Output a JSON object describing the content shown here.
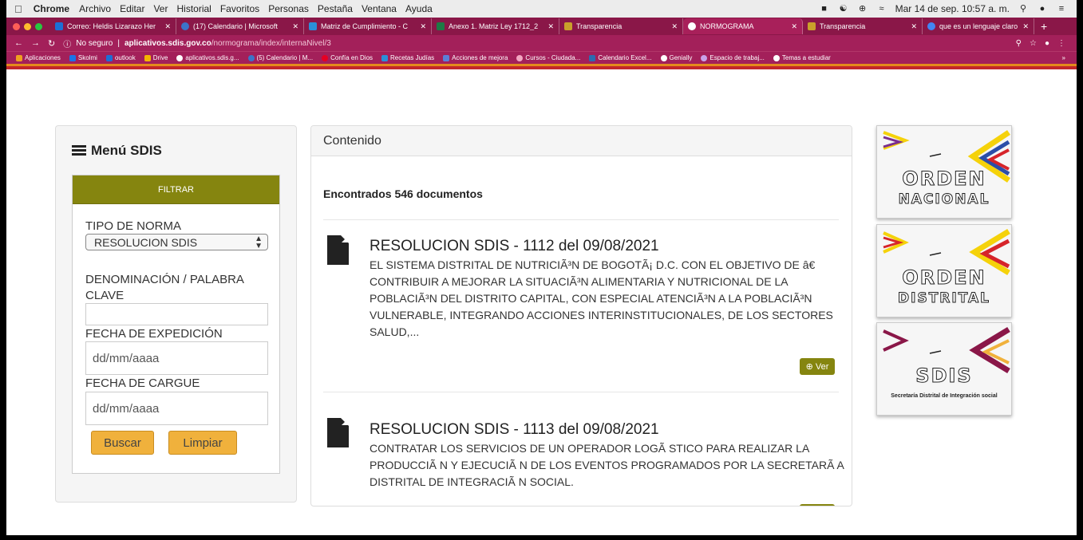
{
  "menubar": {
    "app": "Chrome",
    "items": [
      "Archivo",
      "Editar",
      "Ver",
      "Historial",
      "Favoritos",
      "Personas",
      "Pestaña",
      "Ventana",
      "Ayuda"
    ],
    "datetime": "Mar 14 de sep. 10:57 a. m."
  },
  "tabs": [
    {
      "title": "Correo: Heldis Lizarazo Her",
      "color": "#1c6fd6"
    },
    {
      "title": "(17) Calendario | Microsoft",
      "color": "#3b74c9"
    },
    {
      "title": "Matriz de Cumplimiento - C",
      "color": "#2b8fd8"
    },
    {
      "title": "Anexo 1. Matriz Ley 1712_2",
      "color": "#1e7a45"
    },
    {
      "title": "Transparencia",
      "color": "#c9a12b"
    },
    {
      "title": "NORMOGRAMA",
      "color": "#ffffff",
      "active": true
    },
    {
      "title": "Transparencia",
      "color": "#c9a12b"
    },
    {
      "title": "que es un lenguaje claro -",
      "color": "#4285f4"
    }
  ],
  "address": {
    "security": "No seguro",
    "domain": "aplicativos.sdis.gov.co",
    "path": "/normograma/index/internaNivel/3"
  },
  "bookmarks": [
    {
      "label": "Aplicaciones",
      "color": "#f0a020"
    },
    {
      "label": "Skolmi",
      "color": "#1a73e8"
    },
    {
      "label": "outlook",
      "color": "#1c6fd6"
    },
    {
      "label": "Drive",
      "color": "#f4b400"
    },
    {
      "label": "aplicativos.sdis.g...",
      "color": "#ffffff"
    },
    {
      "label": "(5) Calendario | M...",
      "color": "#3b74c9"
    },
    {
      "label": "Confía en Dios",
      "color": "#e60023"
    },
    {
      "label": "Recetas Judías",
      "color": "#2b8fd8"
    },
    {
      "label": "Acciones de mejora",
      "color": "#5a7fd6"
    },
    {
      "label": "Cursos - Ciudada...",
      "color": "#f3a6c2"
    },
    {
      "label": "Calendario Excel...",
      "color": "#2b6cb0"
    },
    {
      "label": "Genially",
      "color": "#ffffff"
    },
    {
      "label": "Espacio de trabaj...",
      "color": "#c8a2e8"
    },
    {
      "label": "Temas a estudiar",
      "color": "#ffffff"
    }
  ],
  "menu": {
    "title": "Menú SDIS",
    "filter_header": "FILTRAR",
    "tipo_label": "TIPO DE NORMA",
    "tipo_value": "RESOLUCION SDIS",
    "denominacion_label": "DENOMINACIÓN / PALABRA CLAVE",
    "denominacion_value": "",
    "fecha_exp_label": "FECHA DE EXPEDICIÓN",
    "fecha_exp_placeholder": "dd/mm/aaaa",
    "fecha_cargue_label": "FECHA DE CARGUE",
    "fecha_cargue_placeholder": "dd/mm/aaaa",
    "buscar": "Buscar",
    "limpiar": "Limpiar"
  },
  "content": {
    "header": "Contenido",
    "found": "Encontrados 546 documentos",
    "docs": [
      {
        "title": "RESOLUCION SDIS - 1112 del 09/08/2021",
        "desc": "EL SISTEMA DISTRITAL DE NUTRICIÃ³N DE BOGOTÃ¡ D.C. CON EL OBJETIVO DE â€  CONTRIBUIR A MEJORAR LA SITUACIÃ³N ALIMENTARIA Y NUTRICIONAL DE LA POBLACIÃ³N DEL DISTRITO CAPITAL, CON ESPECIAL ATENCIÃ³N A LA POBLACIÃ³N VULNERABLE, INTEGRANDO ACCIONES INTERINSTITUCIONALES, DE LOS SECTORES SALUD,...",
        "ver": "Ver"
      },
      {
        "title": "RESOLUCION SDIS - 1113 del 09/08/2021",
        "desc": "CONTRATAR LOS SERVICIOS DE UN OPERADOR LOGÃ  STICO PARA REALIZAR LA PRODUCCIÃ  N Y EJECUCIÃ  N DE LOS EVENTOS PROGRAMADOS POR LA SECRETARÃ  A DISTRITAL DE INTEGRACIÃ  N SOCIAL."
      }
    ]
  },
  "banners": [
    {
      "line1": "ORDEN",
      "line2": "NACIONAL"
    },
    {
      "line1": "ORDEN",
      "line2": "DISTRITAL"
    },
    {
      "line1": "SDIS",
      "line2": "Secretaría Distrital de Integración social"
    }
  ],
  "colors": {
    "tabstrip": "#8a1748",
    "accent_olive": "#85850f",
    "button_orange": "#f0b13c"
  }
}
